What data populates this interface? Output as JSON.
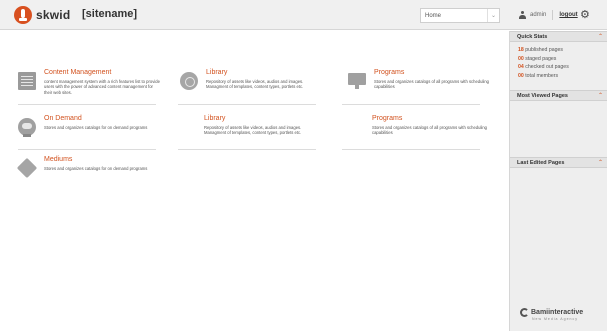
{
  "header": {
    "brand": "skwid",
    "site_name": "[sitename]",
    "site_select": {
      "selected": "Home"
    },
    "user": "admin",
    "logout_label": "logout"
  },
  "modules": [
    {
      "title": "Content Management",
      "description": "content management system with a rich features list to provide users with the power of advanced content management for their web sites.",
      "icon": "document-icon"
    },
    {
      "title": "Library",
      "description": "Repository of assets like videos, audios and images. Managment of templates, content types, portlets etc.",
      "icon": "library-icon"
    },
    {
      "title": "Programs",
      "description": "Stores and organizes catalogs of all programs with scheduling capabilities",
      "icon": "monitor-icon"
    },
    {
      "title": "On Demand",
      "description": "Stores and organizes catalogs for on demand programs",
      "icon": "on-demand-icon"
    },
    {
      "title": "Library",
      "description": "Repository of assets like videos, audios and images. Managment of templates, content types, portlets etc.",
      "icon": "library-icon"
    },
    {
      "title": "Programs",
      "description": "Stores and organizes catalogs of all programs with scheduling capabilities",
      "icon": "monitor-icon"
    },
    {
      "title": "Mediums",
      "description": "Stores and organizes catalogs for on demand programs",
      "icon": "tag-icon"
    }
  ],
  "sidebar": {
    "quick_stats": {
      "title": "Quick Stats",
      "items": [
        {
          "num": "18",
          "label": "published pages"
        },
        {
          "num": "00",
          "label": "staged pages"
        },
        {
          "num": "04",
          "label": "checked out pages"
        },
        {
          "num": "00",
          "label": "total members"
        }
      ]
    },
    "most_viewed": {
      "title": "Most Viewed Pages"
    },
    "last_edited": {
      "title": "Last Edited Pages"
    },
    "partner": {
      "name": "Bamiinteractive",
      "tagline": "New Media Agency"
    }
  },
  "colors": {
    "accent": "#d2521f",
    "header_bg": "#f0f0f0",
    "sidebar_bg": "#eeeeee"
  }
}
